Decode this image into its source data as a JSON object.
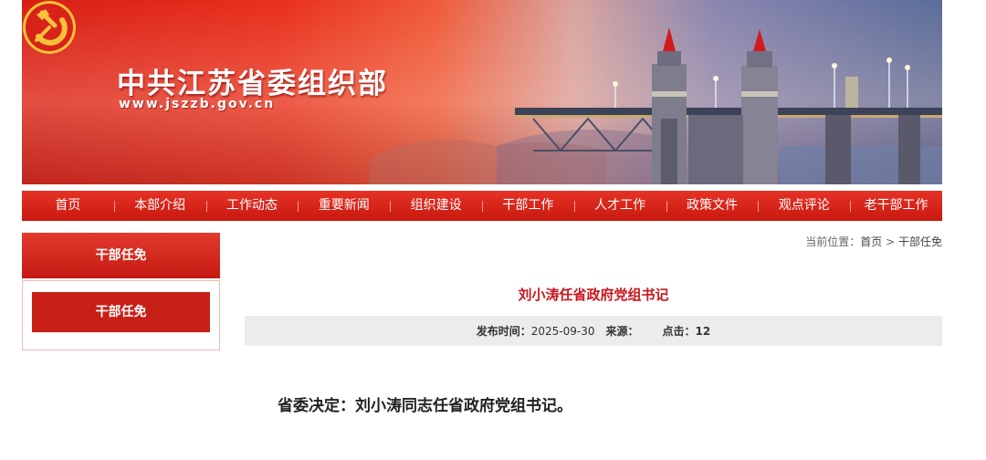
{
  "site": {
    "title": "中共江苏省委组织部",
    "url": "www.jszzb.gov.cn",
    "emblem_icon": "party-emblem-icon"
  },
  "nav": {
    "items": [
      {
        "label": "首页"
      },
      {
        "label": "本部介绍"
      },
      {
        "label": "工作动态"
      },
      {
        "label": "重要新闻"
      },
      {
        "label": "组织建设"
      },
      {
        "label": "干部工作"
      },
      {
        "label": "人才工作"
      },
      {
        "label": "政策文件"
      },
      {
        "label": "观点评论"
      },
      {
        "label": "老干部工作"
      }
    ]
  },
  "sidebar": {
    "heading": "干部任免",
    "link": "干部任免"
  },
  "breadcrumb": {
    "prefix": "当前位置：",
    "home": "首页",
    "separator": ">",
    "current": "干部任免"
  },
  "article": {
    "title": "刘小涛任省政府党组书记",
    "publish_label": "发布时间：",
    "publish_date": "2025-09-30",
    "source_label": "来源：",
    "source_value": "",
    "clicks_label": "点击：",
    "clicks_value": "12",
    "body": "省委决定：刘小涛同志任省政府党组书记。"
  },
  "colors": {
    "brand_red": "#c8161d",
    "nav_red": "#d4231a",
    "meta_bg": "#ececec"
  }
}
